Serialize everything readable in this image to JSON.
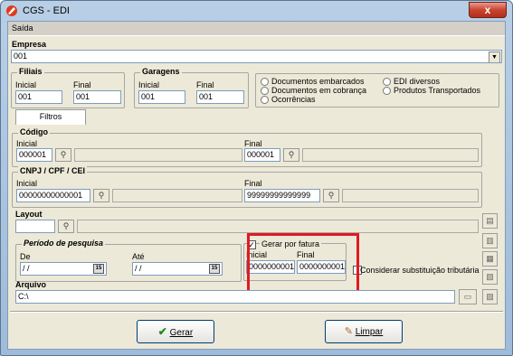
{
  "window": {
    "title": "CGS - EDI",
    "close_label": "x"
  },
  "menu": {
    "items": [
      "Saída"
    ]
  },
  "empresa": {
    "label": "Empresa",
    "value": "001"
  },
  "filiais": {
    "title": "Filiais",
    "inicial_label": "Inicial",
    "inicial_value": "001",
    "final_label": "Final",
    "final_value": "001"
  },
  "garagens": {
    "title": "Garagens",
    "inicial_label": "Inicial",
    "inicial_value": "001",
    "final_label": "Final",
    "final_value": "001"
  },
  "tipos": {
    "documentos_embarcados": "Documentos embarcados",
    "documentos_cobranca": "Documentos em cobrança",
    "ocorrencias": "Ocorrências",
    "edi_diversos": "EDI diversos",
    "produtos_transportados": "Produtos Transportados"
  },
  "tabs": {
    "filtros": "Filtros"
  },
  "codigo": {
    "title": "Código",
    "inicial_label": "Inicial",
    "inicial_value": "000001",
    "final_label": "Final",
    "final_value": "000001"
  },
  "cnpj": {
    "title": "CNPJ / CPF / CEI",
    "inicial_label": "Inicial",
    "inicial_value": "00000000000001",
    "final_label": "Final",
    "final_value": "99999999999999"
  },
  "layout": {
    "title": "Layout"
  },
  "periodo": {
    "title": "Período de pesquisa",
    "de_label": "De",
    "de_value": "  /  /",
    "ate_label": "Até",
    "ate_value": "  /  /"
  },
  "fatura": {
    "checkbox_label": "Gerar por fatura",
    "inicial_label": "Inicial",
    "inicial_value": "0000000001",
    "final_label": "Final",
    "final_value": "0000000001"
  },
  "substituicao": {
    "label": "Considerar substituição tributária"
  },
  "arquivo": {
    "label": "Arquivo",
    "value": "C:\\"
  },
  "buttons": {
    "gerar": "Gerar",
    "limpar": "Limpar"
  },
  "colors": {
    "accent": "#e01a22",
    "window_bg": "#ece9d8"
  }
}
